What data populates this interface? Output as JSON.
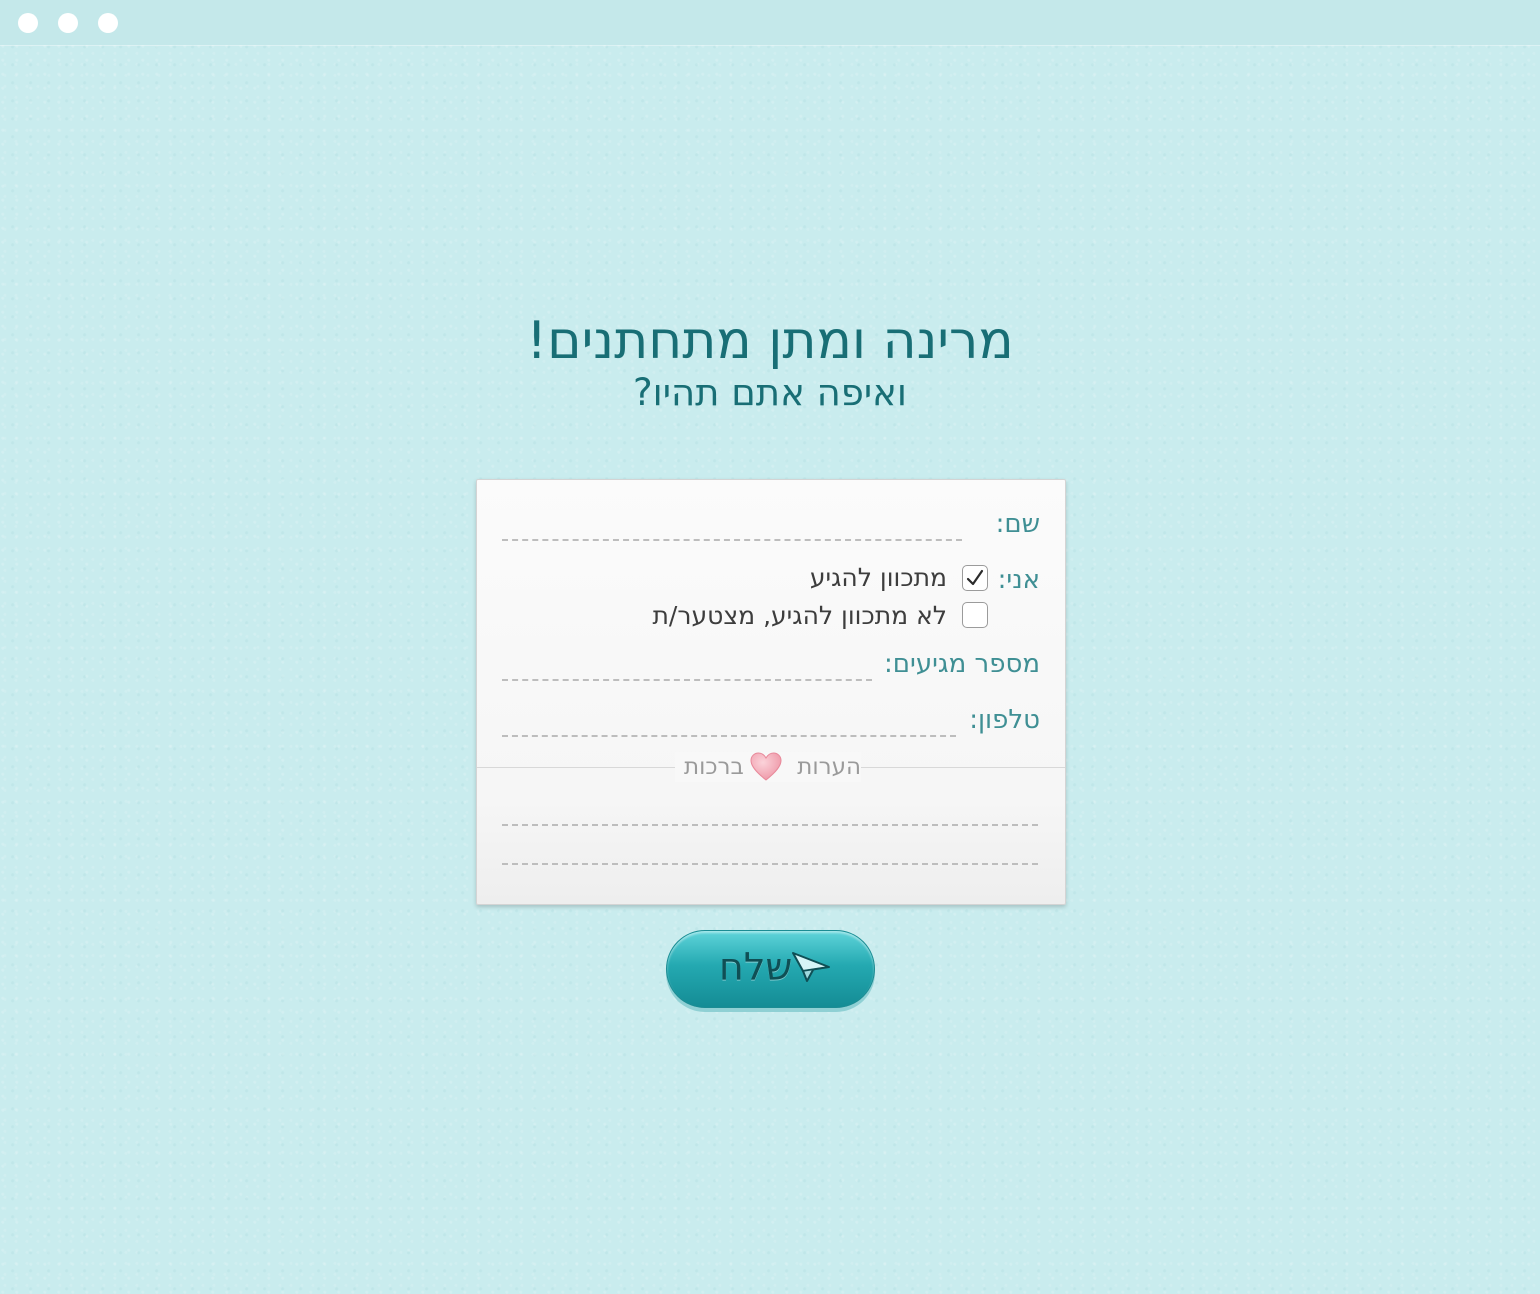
{
  "window": {
    "controls": [
      "close",
      "minimize",
      "maximize"
    ]
  },
  "header": {
    "title": "מרינה ומתן מתחתנים!",
    "subtitle": "ואיפה אתם תהיו?"
  },
  "form": {
    "name_label": "שם:",
    "attendance_label": "אני:",
    "options": [
      {
        "label": "מתכוון להגיע",
        "checked": true
      },
      {
        "label": "לא מתכוון להגיע, מצטער/ת",
        "checked": false
      }
    ],
    "guests_label": "מספר מגיעים:",
    "phone_label": "טלפון:",
    "notes_title_left": "ברכות",
    "notes_title_right": "הערות",
    "send_label": "שלח"
  },
  "icons": {
    "heart": "heart-icon",
    "send": "paper-plane-icon",
    "check": "checkmark-icon"
  },
  "colors": {
    "background": "#cbedef",
    "heading": "#186e75",
    "label": "#3f8f94",
    "button": "#24a9b1",
    "heart": "#f2a3b0"
  }
}
